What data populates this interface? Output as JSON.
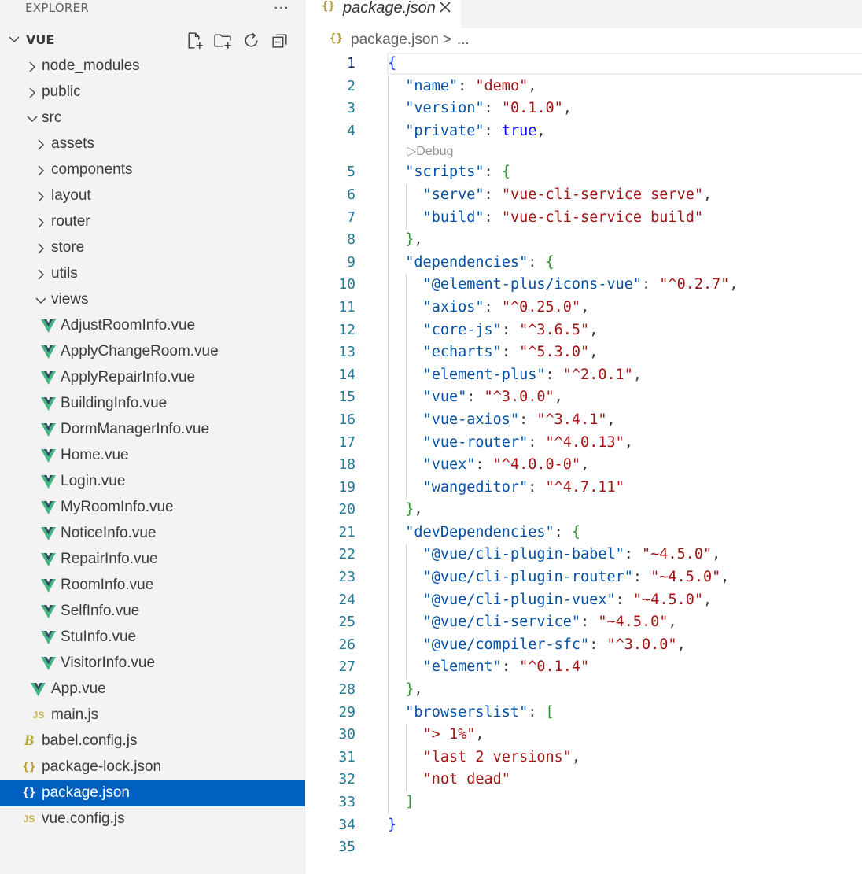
{
  "explorer": {
    "title": "EXPLORER",
    "more_label": "···",
    "section_title": "VUE"
  },
  "tree": [
    {
      "label": "node_modules",
      "kind": "folder",
      "depth": 0,
      "expanded": false
    },
    {
      "label": "public",
      "kind": "folder",
      "depth": 0,
      "expanded": false
    },
    {
      "label": "src",
      "kind": "folder",
      "depth": 0,
      "expanded": true
    },
    {
      "label": "assets",
      "kind": "folder",
      "depth": 1,
      "expanded": false
    },
    {
      "label": "components",
      "kind": "folder",
      "depth": 1,
      "expanded": false
    },
    {
      "label": "layout",
      "kind": "folder",
      "depth": 1,
      "expanded": false
    },
    {
      "label": "router",
      "kind": "folder",
      "depth": 1,
      "expanded": false
    },
    {
      "label": "store",
      "kind": "folder",
      "depth": 1,
      "expanded": false
    },
    {
      "label": "utils",
      "kind": "folder",
      "depth": 1,
      "expanded": false
    },
    {
      "label": "views",
      "kind": "folder",
      "depth": 1,
      "expanded": true
    },
    {
      "label": "AdjustRoomInfo.vue",
      "kind": "vue",
      "depth": 2
    },
    {
      "label": "ApplyChangeRoom.vue",
      "kind": "vue",
      "depth": 2
    },
    {
      "label": "ApplyRepairInfo.vue",
      "kind": "vue",
      "depth": 2
    },
    {
      "label": "BuildingInfo.vue",
      "kind": "vue",
      "depth": 2
    },
    {
      "label": "DormManagerInfo.vue",
      "kind": "vue",
      "depth": 2
    },
    {
      "label": "Home.vue",
      "kind": "vue",
      "depth": 2
    },
    {
      "label": "Login.vue",
      "kind": "vue",
      "depth": 2
    },
    {
      "label": "MyRoomInfo.vue",
      "kind": "vue",
      "depth": 2
    },
    {
      "label": "NoticeInfo.vue",
      "kind": "vue",
      "depth": 2
    },
    {
      "label": "RepairInfo.vue",
      "kind": "vue",
      "depth": 2
    },
    {
      "label": "RoomInfo.vue",
      "kind": "vue",
      "depth": 2
    },
    {
      "label": "SelfInfo.vue",
      "kind": "vue",
      "depth": 2
    },
    {
      "label": "StuInfo.vue",
      "kind": "vue",
      "depth": 2
    },
    {
      "label": "VisitorInfo.vue",
      "kind": "vue",
      "depth": 2
    },
    {
      "label": "App.vue",
      "kind": "vue",
      "depth": 1
    },
    {
      "label": "main.js",
      "kind": "js",
      "depth": 1,
      "icon_text": "JS"
    },
    {
      "label": "babel.config.js",
      "kind": "babel",
      "depth": 0,
      "icon_text": "B"
    },
    {
      "label": "package-lock.json",
      "kind": "json",
      "depth": 0,
      "icon_text": "{}"
    },
    {
      "label": "package.json",
      "kind": "json",
      "depth": 0,
      "icon_text": "{}",
      "selected": true
    },
    {
      "label": "vue.config.js",
      "kind": "js",
      "depth": 0,
      "icon_text": "JS"
    }
  ],
  "tab": {
    "icon_text": "{}",
    "label": "package.json"
  },
  "breadcrumb": {
    "icon_text": "{}",
    "file": "package.json",
    "separator": ">",
    "more": "..."
  },
  "codelens": {
    "label": "▷Debug",
    "after_line": 4
  },
  "active_line": 1,
  "code_lines": [
    [
      {
        "t": "{",
        "c": "br1"
      }
    ],
    [
      {
        "t": "  "
      },
      {
        "t": "\"name\"",
        "c": "tok-key"
      },
      {
        "t": ": "
      },
      {
        "t": "\"demo\"",
        "c": "tok-str"
      },
      {
        "t": ","
      }
    ],
    [
      {
        "t": "  "
      },
      {
        "t": "\"version\"",
        "c": "tok-key"
      },
      {
        "t": ": "
      },
      {
        "t": "\"0.1.0\"",
        "c": "tok-str"
      },
      {
        "t": ","
      }
    ],
    [
      {
        "t": "  "
      },
      {
        "t": "\"private\"",
        "c": "tok-key"
      },
      {
        "t": ": "
      },
      {
        "t": "true",
        "c": "tok-bool"
      },
      {
        "t": ","
      }
    ],
    [
      {
        "t": "  "
      },
      {
        "t": "\"scripts\"",
        "c": "tok-key"
      },
      {
        "t": ": "
      },
      {
        "t": "{",
        "c": "br2"
      }
    ],
    [
      {
        "t": "    "
      },
      {
        "t": "\"serve\"",
        "c": "tok-key"
      },
      {
        "t": ": "
      },
      {
        "t": "\"vue-cli-service serve\"",
        "c": "tok-str"
      },
      {
        "t": ","
      }
    ],
    [
      {
        "t": "    "
      },
      {
        "t": "\"build\"",
        "c": "tok-key"
      },
      {
        "t": ": "
      },
      {
        "t": "\"vue-cli-service build\"",
        "c": "tok-str"
      }
    ],
    [
      {
        "t": "  "
      },
      {
        "t": "}",
        "c": "br2"
      },
      {
        "t": ","
      }
    ],
    [
      {
        "t": "  "
      },
      {
        "t": "\"dependencies\"",
        "c": "tok-key"
      },
      {
        "t": ": "
      },
      {
        "t": "{",
        "c": "br2"
      }
    ],
    [
      {
        "t": "    "
      },
      {
        "t": "\"@element-plus/icons-vue\"",
        "c": "tok-key"
      },
      {
        "t": ": "
      },
      {
        "t": "\"^0.2.7\"",
        "c": "tok-str"
      },
      {
        "t": ","
      }
    ],
    [
      {
        "t": "    "
      },
      {
        "t": "\"axios\"",
        "c": "tok-key"
      },
      {
        "t": ": "
      },
      {
        "t": "\"^0.25.0\"",
        "c": "tok-str"
      },
      {
        "t": ","
      }
    ],
    [
      {
        "t": "    "
      },
      {
        "t": "\"core-js\"",
        "c": "tok-key"
      },
      {
        "t": ": "
      },
      {
        "t": "\"^3.6.5\"",
        "c": "tok-str"
      },
      {
        "t": ","
      }
    ],
    [
      {
        "t": "    "
      },
      {
        "t": "\"echarts\"",
        "c": "tok-key"
      },
      {
        "t": ": "
      },
      {
        "t": "\"^5.3.0\"",
        "c": "tok-str"
      },
      {
        "t": ","
      }
    ],
    [
      {
        "t": "    "
      },
      {
        "t": "\"element-plus\"",
        "c": "tok-key"
      },
      {
        "t": ": "
      },
      {
        "t": "\"^2.0.1\"",
        "c": "tok-str"
      },
      {
        "t": ","
      }
    ],
    [
      {
        "t": "    "
      },
      {
        "t": "\"vue\"",
        "c": "tok-key"
      },
      {
        "t": ": "
      },
      {
        "t": "\"^3.0.0\"",
        "c": "tok-str"
      },
      {
        "t": ","
      }
    ],
    [
      {
        "t": "    "
      },
      {
        "t": "\"vue-axios\"",
        "c": "tok-key"
      },
      {
        "t": ": "
      },
      {
        "t": "\"^3.4.1\"",
        "c": "tok-str"
      },
      {
        "t": ","
      }
    ],
    [
      {
        "t": "    "
      },
      {
        "t": "\"vue-router\"",
        "c": "tok-key"
      },
      {
        "t": ": "
      },
      {
        "t": "\"^4.0.13\"",
        "c": "tok-str"
      },
      {
        "t": ","
      }
    ],
    [
      {
        "t": "    "
      },
      {
        "t": "\"vuex\"",
        "c": "tok-key"
      },
      {
        "t": ": "
      },
      {
        "t": "\"^4.0.0-0\"",
        "c": "tok-str"
      },
      {
        "t": ","
      }
    ],
    [
      {
        "t": "    "
      },
      {
        "t": "\"wangeditor\"",
        "c": "tok-key"
      },
      {
        "t": ": "
      },
      {
        "t": "\"^4.7.11\"",
        "c": "tok-str"
      }
    ],
    [
      {
        "t": "  "
      },
      {
        "t": "}",
        "c": "br2"
      },
      {
        "t": ","
      }
    ],
    [
      {
        "t": "  "
      },
      {
        "t": "\"devDependencies\"",
        "c": "tok-key"
      },
      {
        "t": ": "
      },
      {
        "t": "{",
        "c": "br2"
      }
    ],
    [
      {
        "t": "    "
      },
      {
        "t": "\"@vue/cli-plugin-babel\"",
        "c": "tok-key"
      },
      {
        "t": ": "
      },
      {
        "t": "\"~4.5.0\"",
        "c": "tok-str"
      },
      {
        "t": ","
      }
    ],
    [
      {
        "t": "    "
      },
      {
        "t": "\"@vue/cli-plugin-router\"",
        "c": "tok-key"
      },
      {
        "t": ": "
      },
      {
        "t": "\"~4.5.0\"",
        "c": "tok-str"
      },
      {
        "t": ","
      }
    ],
    [
      {
        "t": "    "
      },
      {
        "t": "\"@vue/cli-plugin-vuex\"",
        "c": "tok-key"
      },
      {
        "t": ": "
      },
      {
        "t": "\"~4.5.0\"",
        "c": "tok-str"
      },
      {
        "t": ","
      }
    ],
    [
      {
        "t": "    "
      },
      {
        "t": "\"@vue/cli-service\"",
        "c": "tok-key"
      },
      {
        "t": ": "
      },
      {
        "t": "\"~4.5.0\"",
        "c": "tok-str"
      },
      {
        "t": ","
      }
    ],
    [
      {
        "t": "    "
      },
      {
        "t": "\"@vue/compiler-sfc\"",
        "c": "tok-key"
      },
      {
        "t": ": "
      },
      {
        "t": "\"^3.0.0\"",
        "c": "tok-str"
      },
      {
        "t": ","
      }
    ],
    [
      {
        "t": "    "
      },
      {
        "t": "\"element\"",
        "c": "tok-key"
      },
      {
        "t": ": "
      },
      {
        "t": "\"^0.1.4\"",
        "c": "tok-str"
      }
    ],
    [
      {
        "t": "  "
      },
      {
        "t": "}",
        "c": "br2"
      },
      {
        "t": ","
      }
    ],
    [
      {
        "t": "  "
      },
      {
        "t": "\"browserslist\"",
        "c": "tok-key"
      },
      {
        "t": ": "
      },
      {
        "t": "[",
        "c": "br2"
      }
    ],
    [
      {
        "t": "    "
      },
      {
        "t": "\"> 1%\"",
        "c": "tok-str"
      },
      {
        "t": ","
      }
    ],
    [
      {
        "t": "    "
      },
      {
        "t": "\"last 2 versions\"",
        "c": "tok-str"
      },
      {
        "t": ","
      }
    ],
    [
      {
        "t": "    "
      },
      {
        "t": "\"not dead\"",
        "c": "tok-str"
      }
    ],
    [
      {
        "t": "  "
      },
      {
        "t": "]",
        "c": "br2"
      }
    ],
    [
      {
        "t": "}",
        "c": "br1"
      }
    ],
    []
  ],
  "colors": {
    "selection": "#0060c0",
    "sidebar_bg": "#f3f3f3",
    "vue_green": "#41b883",
    "json_key": "#0451a5",
    "json_string": "#a31515",
    "json_bool": "#0000ff",
    "line_number": "#237893"
  }
}
